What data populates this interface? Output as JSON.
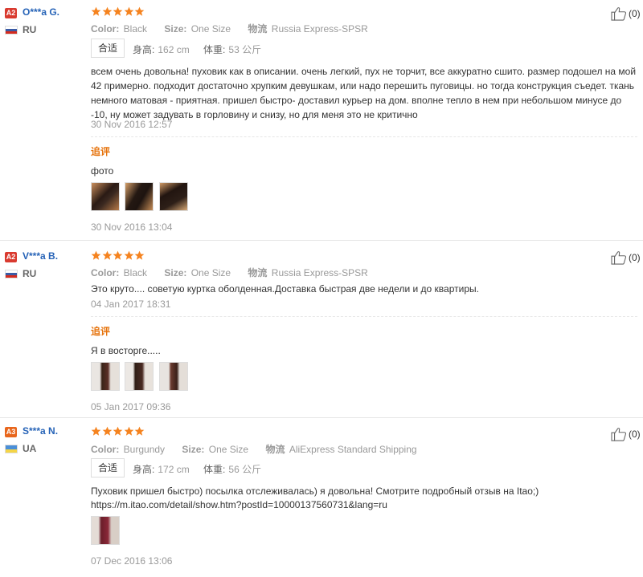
{
  "labels": {
    "color": "Color:",
    "size": "Size:",
    "shipping": "物流",
    "fit": "合适",
    "height": "身高:",
    "weight": "体重:",
    "followup": "追评"
  },
  "reviews": [
    {
      "badge": "A2",
      "user": "O***a G.",
      "country": "RU",
      "stars": 5,
      "color": "Black",
      "size": "One Size",
      "shipping": "Russia Express-SPSR",
      "has_body": true,
      "height": "162 cm",
      "weight": "53 公斤",
      "text": "всем очень довольна! пуховик как в описании. очень легкий, пух не торчит, все аккуратно сшито. размер подошел на мой 42 примерно. подходит достаточно хрупким девушкам, или надо перешить пуговицы. но тогда конструкция съедет. ткань немного матовая - приятная. пришел быстро- доставил курьер на дом. вполне тепло в нем при небольшом минусе до -10, ну может задувать в горловину и снизу, но для меня это не критично",
      "date": "30 Nov 2016 12:57",
      "followup_text": "фото",
      "followup_date": "30 Nov 2016 13:04",
      "likes": "(0)"
    },
    {
      "badge": "A2",
      "user": "V***a B.",
      "country": "RU",
      "stars": 5,
      "color": "Black",
      "size": "One Size",
      "shipping": "Russia Express-SPSR",
      "has_body": false,
      "text": "Это круто.... советую куртка оболденная.Доставка быстрая две недели и до квартиры.",
      "date": "04 Jan 2017 18:31",
      "followup_text": "Я в восторге.....",
      "followup_date": "05 Jan 2017 09:36",
      "likes": "(0)"
    },
    {
      "badge": "A3",
      "user": "S***a N.",
      "country": "UA",
      "stars": 5,
      "color": "Burgundy",
      "size": "One Size",
      "shipping": "AliExpress Standard Shipping",
      "has_body": true,
      "height": "172 cm",
      "weight": "56 公斤",
      "text_line1": "Пуховик пришел быстро) посылка отслеживалась) я довольна! Смотрите подробный отзыв на Itao;)",
      "text_line2": "https://m.itao.com/detail/show.htm?postId=10000137560731&lang=ru",
      "date": "07 Dec 2016 13:06",
      "likes": "(0)"
    }
  ]
}
